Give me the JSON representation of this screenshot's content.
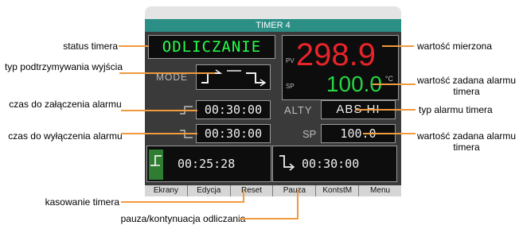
{
  "device": {
    "title": "TIMER 4",
    "status": "ODLICZANIE",
    "pv_tag": "PV",
    "sp_tag": "SP",
    "measured_value": "298.9",
    "setpoint_value": "100.0",
    "unit": "°C",
    "mode_label": "MODE",
    "on_delay": "00:30:00",
    "off_delay": "00:30:00",
    "alty_label": "ALTY",
    "alarm_type": "ABS HI",
    "sp_label": "SP",
    "alarm_setpoint": "100.0",
    "elapsed_time": "00:25:28",
    "remaining_time": "00:30:00",
    "softkeys": [
      "Ekrany",
      "Edycja",
      "Reset",
      "Pauza",
      "KontstM",
      "Menu"
    ]
  },
  "annotations": {
    "timer_status": "status timera",
    "output_hold_type": "typ podtrzymywania wyjścia",
    "alarm_on_time": "czas do załączenia alarmu",
    "alarm_off_time": "czas do wyłączenia alarmu",
    "timer_reset": "kasowanie timera",
    "pause_resume": "pauza/kontynuacja odliczania",
    "measured_value": "wartość mierzona",
    "timer_alarm_setpoint": "wartość zadana alarmu timera",
    "timer_alarm_type": "typ alarmu timera",
    "timer_alarm_setpoint_2": "wartość zadana alarmu timera"
  },
  "colors": {
    "titlebar": "#2b8f86",
    "status_text": "#27ff4c",
    "measured": "#e8242a",
    "setpoint": "#27d444",
    "leader_line": "#f19a3e"
  }
}
